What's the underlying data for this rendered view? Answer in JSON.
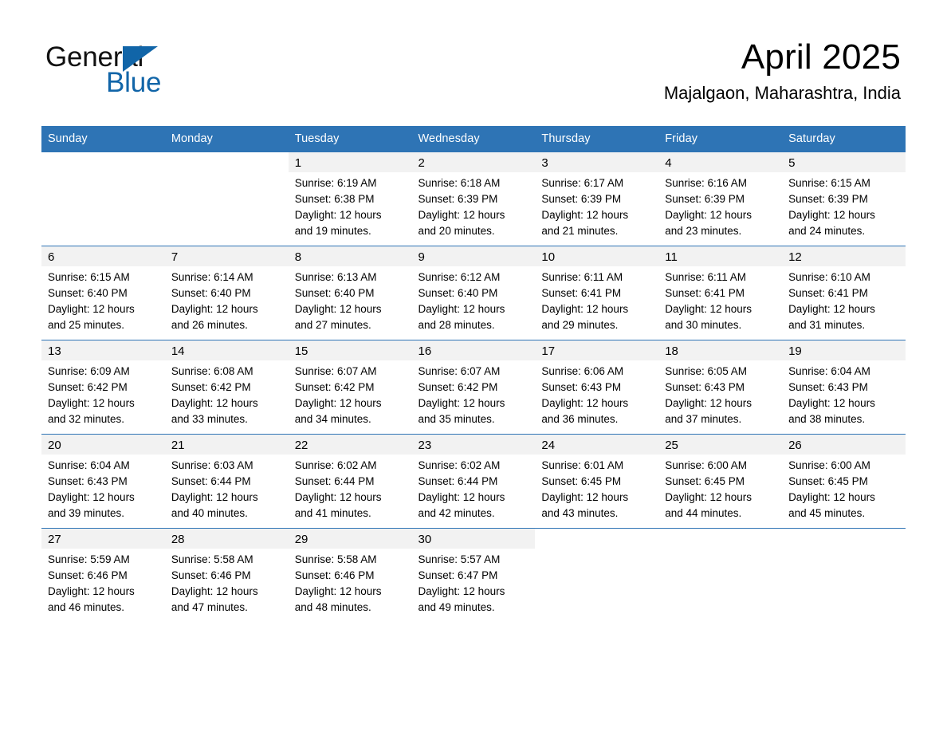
{
  "brand": {
    "name_part1": "General",
    "name_part2": "Blue",
    "accent_color": "#1165a8",
    "triangle_icon": "triangle-right-icon"
  },
  "header": {
    "title": "April 2025",
    "location": "Majalgaon, Maharashtra, India"
  },
  "calendar": {
    "header_background": "#2e74b5",
    "header_text_color": "#ffffff",
    "daynum_band_color": "#f2f2f2",
    "weekday_headers": [
      "Sunday",
      "Monday",
      "Tuesday",
      "Wednesday",
      "Thursday",
      "Friday",
      "Saturday"
    ],
    "weeks": [
      [
        {
          "day": "",
          "blank": true,
          "lines": []
        },
        {
          "day": "",
          "blank": true,
          "lines": []
        },
        {
          "day": "1",
          "lines": [
            "Sunrise: 6:19 AM",
            "Sunset: 6:38 PM",
            "Daylight: 12 hours",
            "and 19 minutes."
          ]
        },
        {
          "day": "2",
          "lines": [
            "Sunrise: 6:18 AM",
            "Sunset: 6:39 PM",
            "Daylight: 12 hours",
            "and 20 minutes."
          ]
        },
        {
          "day": "3",
          "lines": [
            "Sunrise: 6:17 AM",
            "Sunset: 6:39 PM",
            "Daylight: 12 hours",
            "and 21 minutes."
          ]
        },
        {
          "day": "4",
          "lines": [
            "Sunrise: 6:16 AM",
            "Sunset: 6:39 PM",
            "Daylight: 12 hours",
            "and 23 minutes."
          ]
        },
        {
          "day": "5",
          "lines": [
            "Sunrise: 6:15 AM",
            "Sunset: 6:39 PM",
            "Daylight: 12 hours",
            "and 24 minutes."
          ]
        }
      ],
      [
        {
          "day": "6",
          "lines": [
            "Sunrise: 6:15 AM",
            "Sunset: 6:40 PM",
            "Daylight: 12 hours",
            "and 25 minutes."
          ]
        },
        {
          "day": "7",
          "lines": [
            "Sunrise: 6:14 AM",
            "Sunset: 6:40 PM",
            "Daylight: 12 hours",
            "and 26 minutes."
          ]
        },
        {
          "day": "8",
          "lines": [
            "Sunrise: 6:13 AM",
            "Sunset: 6:40 PM",
            "Daylight: 12 hours",
            "and 27 minutes."
          ]
        },
        {
          "day": "9",
          "lines": [
            "Sunrise: 6:12 AM",
            "Sunset: 6:40 PM",
            "Daylight: 12 hours",
            "and 28 minutes."
          ]
        },
        {
          "day": "10",
          "lines": [
            "Sunrise: 6:11 AM",
            "Sunset: 6:41 PM",
            "Daylight: 12 hours",
            "and 29 minutes."
          ]
        },
        {
          "day": "11",
          "lines": [
            "Sunrise: 6:11 AM",
            "Sunset: 6:41 PM",
            "Daylight: 12 hours",
            "and 30 minutes."
          ]
        },
        {
          "day": "12",
          "lines": [
            "Sunrise: 6:10 AM",
            "Sunset: 6:41 PM",
            "Daylight: 12 hours",
            "and 31 minutes."
          ]
        }
      ],
      [
        {
          "day": "13",
          "lines": [
            "Sunrise: 6:09 AM",
            "Sunset: 6:42 PM",
            "Daylight: 12 hours",
            "and 32 minutes."
          ]
        },
        {
          "day": "14",
          "lines": [
            "Sunrise: 6:08 AM",
            "Sunset: 6:42 PM",
            "Daylight: 12 hours",
            "and 33 minutes."
          ]
        },
        {
          "day": "15",
          "lines": [
            "Sunrise: 6:07 AM",
            "Sunset: 6:42 PM",
            "Daylight: 12 hours",
            "and 34 minutes."
          ]
        },
        {
          "day": "16",
          "lines": [
            "Sunrise: 6:07 AM",
            "Sunset: 6:42 PM",
            "Daylight: 12 hours",
            "and 35 minutes."
          ]
        },
        {
          "day": "17",
          "lines": [
            "Sunrise: 6:06 AM",
            "Sunset: 6:43 PM",
            "Daylight: 12 hours",
            "and 36 minutes."
          ]
        },
        {
          "day": "18",
          "lines": [
            "Sunrise: 6:05 AM",
            "Sunset: 6:43 PM",
            "Daylight: 12 hours",
            "and 37 minutes."
          ]
        },
        {
          "day": "19",
          "lines": [
            "Sunrise: 6:04 AM",
            "Sunset: 6:43 PM",
            "Daylight: 12 hours",
            "and 38 minutes."
          ]
        }
      ],
      [
        {
          "day": "20",
          "lines": [
            "Sunrise: 6:04 AM",
            "Sunset: 6:43 PM",
            "Daylight: 12 hours",
            "and 39 minutes."
          ]
        },
        {
          "day": "21",
          "lines": [
            "Sunrise: 6:03 AM",
            "Sunset: 6:44 PM",
            "Daylight: 12 hours",
            "and 40 minutes."
          ]
        },
        {
          "day": "22",
          "lines": [
            "Sunrise: 6:02 AM",
            "Sunset: 6:44 PM",
            "Daylight: 12 hours",
            "and 41 minutes."
          ]
        },
        {
          "day": "23",
          "lines": [
            "Sunrise: 6:02 AM",
            "Sunset: 6:44 PM",
            "Daylight: 12 hours",
            "and 42 minutes."
          ]
        },
        {
          "day": "24",
          "lines": [
            "Sunrise: 6:01 AM",
            "Sunset: 6:45 PM",
            "Daylight: 12 hours",
            "and 43 minutes."
          ]
        },
        {
          "day": "25",
          "lines": [
            "Sunrise: 6:00 AM",
            "Sunset: 6:45 PM",
            "Daylight: 12 hours",
            "and 44 minutes."
          ]
        },
        {
          "day": "26",
          "lines": [
            "Sunrise: 6:00 AM",
            "Sunset: 6:45 PM",
            "Daylight: 12 hours",
            "and 45 minutes."
          ]
        }
      ],
      [
        {
          "day": "27",
          "lines": [
            "Sunrise: 5:59 AM",
            "Sunset: 6:46 PM",
            "Daylight: 12 hours",
            "and 46 minutes."
          ]
        },
        {
          "day": "28",
          "lines": [
            "Sunrise: 5:58 AM",
            "Sunset: 6:46 PM",
            "Daylight: 12 hours",
            "and 47 minutes."
          ]
        },
        {
          "day": "29",
          "lines": [
            "Sunrise: 5:58 AM",
            "Sunset: 6:46 PM",
            "Daylight: 12 hours",
            "and 48 minutes."
          ]
        },
        {
          "day": "30",
          "lines": [
            "Sunrise: 5:57 AM",
            "Sunset: 6:47 PM",
            "Daylight: 12 hours",
            "and 49 minutes."
          ]
        },
        {
          "day": "",
          "blank": true,
          "lines": []
        },
        {
          "day": "",
          "blank": true,
          "lines": []
        },
        {
          "day": "",
          "blank": true,
          "lines": []
        }
      ]
    ]
  }
}
